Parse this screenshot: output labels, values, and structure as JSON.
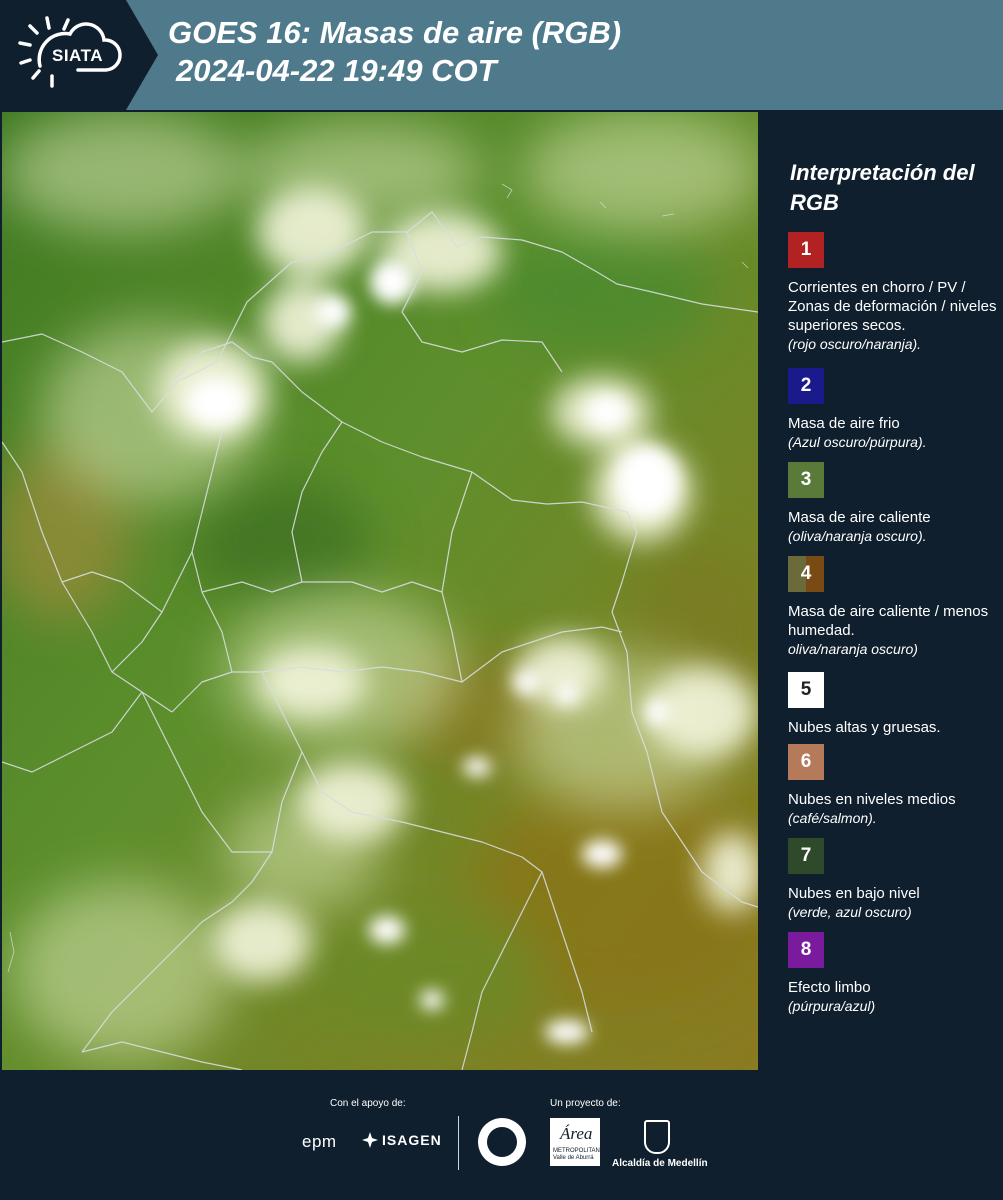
{
  "header": {
    "logo_text": "SIATA",
    "title_line1": "GOES 16: Masas de aire (RGB)",
    "title_line2": "2024-04-22 19:49 COT"
  },
  "legend": {
    "title": "Interpretación del RGB",
    "items": [
      {
        "number": "1",
        "color": "#b22222",
        "description": "Corrientes en chorro / PV / Zonas de deformación / niveles superiores secos.",
        "note": "(rojo oscuro/naranja)."
      },
      {
        "number": "2",
        "color": "#1a1a8c",
        "description": "Masa de aire frio",
        "note": "(Azul oscuro/púrpura)."
      },
      {
        "number": "3",
        "color": "#5a7a3a",
        "description": "Masa de aire caliente",
        "note": "(oliva/naranja oscuro)."
      },
      {
        "number": "4",
        "color": "#6b5a2a",
        "description": "Masa de aire caliente / menos humedad.",
        "note": "oliva/naranja oscuro)"
      },
      {
        "number": "5",
        "color": "#ffffff",
        "description": "Nubes altas y gruesas.",
        "note": ""
      },
      {
        "number": "6",
        "color": "#b47a5a",
        "description": "Nubes en niveles medios",
        "note": "(café/salmon)."
      },
      {
        "number": "7",
        "color": "#2e4a2a",
        "description": "Nubes en bajo nivel",
        "note": "(verde, azul oscuro)"
      },
      {
        "number": "8",
        "color": "#7a1a9c",
        "description": "Efecto limbo",
        "note": "(púrpura/azul)"
      }
    ]
  },
  "footer": {
    "support_label": "Con el apoyo de:",
    "project_label": "Un proyecto de:",
    "epm": "epm",
    "isagen": "ISAGEN",
    "area_word": "Área",
    "area_sub1": "METROPOLITANA",
    "area_sub2": "Valle de Aburrá",
    "alcaldia": "Alcaldía de Medellín"
  },
  "colors": {
    "header_bg": "#4e7a8c",
    "panel_bg": "#0f1f2e",
    "vegetation_green": "#5a8a2a",
    "cloud_white": "#f4f6e8"
  },
  "icons": {
    "logo": "sun-cloud-icon",
    "isagen": "isagen-star-icon"
  }
}
